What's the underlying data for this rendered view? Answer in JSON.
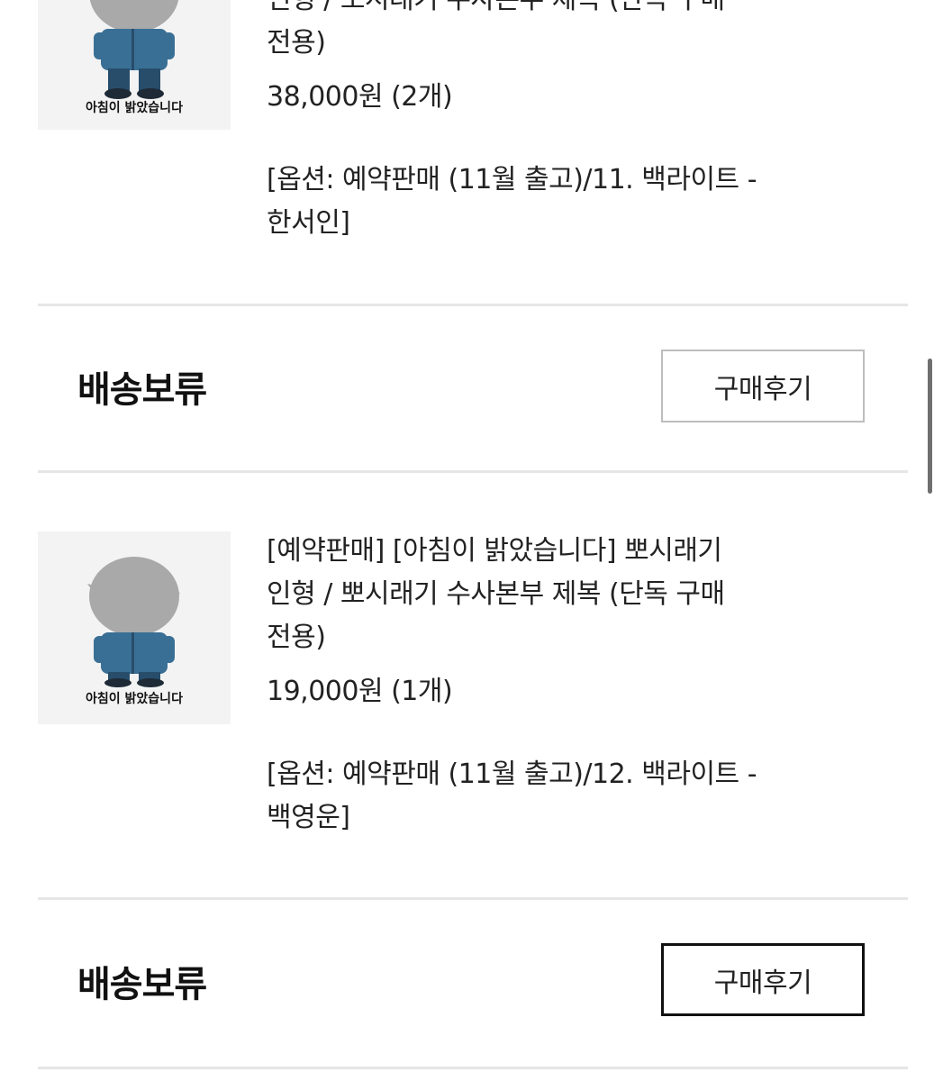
{
  "orders": [
    {
      "title_lines": [
        "인형 / 뽀시래기 수사본부 제복 (단독 구매",
        "전용)"
      ],
      "price": "38,000원 (2개)",
      "option": "[옵션: 예약판매 (11월 출고)/11. 백라이트 - 한서인]",
      "thumb_caption": "아침이 밝았습니다",
      "status": "배송보류",
      "review_label": "구매후기"
    },
    {
      "title_lines": [
        "[예약판매] [아침이 밝았습니다] 뽀시래기",
        "인형 / 뽀시래기 수사본부 제복 (단독 구매",
        "전용)"
      ],
      "price": "19,000원 (1개)",
      "option": "[옵션: 예약판매 (11월 출고)/12. 백라이트 - 백영운]",
      "thumb_caption": "아침이 밝았습니다",
      "status": "배송보류",
      "review_label": "구매후기"
    }
  ],
  "colors": {
    "uniform": "#3a6f95",
    "hair": "#a9a9a9",
    "divider": "#e6e6e6"
  }
}
